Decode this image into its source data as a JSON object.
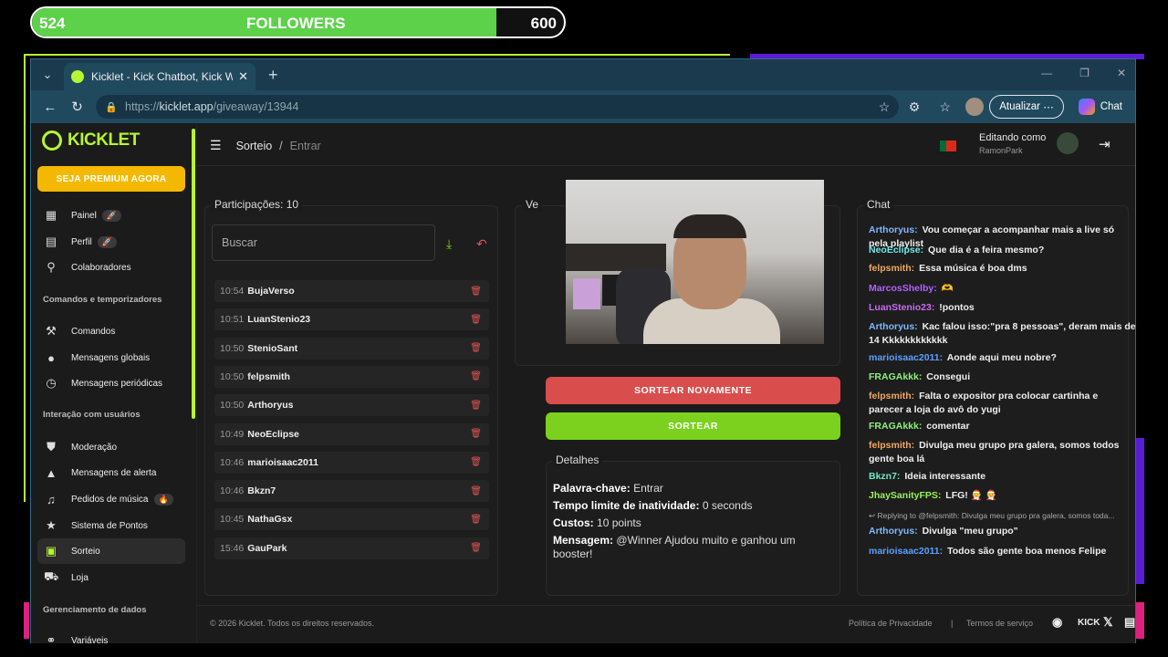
{
  "overlay": {
    "current": "524",
    "label": "FOLLOWERS",
    "goal": "600",
    "progress": 0.873
  },
  "browser": {
    "tab_title": "Kicklet - Kick Chatbot, Kick Widget",
    "url_scheme": "https://",
    "url_host": "kicklet.app",
    "url_path": "/giveaway/13944",
    "update_label": "Atualizar",
    "chat_label": "Chat"
  },
  "sidebar": {
    "logo": "KICKLET",
    "premium": "SEJA PREMIUM AGORA",
    "items": [
      {
        "label": "Painel",
        "icon": "dashboard-icon",
        "glyph": "▦"
      },
      {
        "label": "Perfil",
        "icon": "profile-icon",
        "glyph": "▤"
      },
      {
        "label": "Colaboradores",
        "icon": "collaborators-icon",
        "glyph": "⚲"
      },
      {
        "label": "Comandos",
        "icon": "hammer-icon",
        "glyph": "⚒"
      },
      {
        "label": "Mensagens globais",
        "icon": "chat-bubble-icon",
        "glyph": "●"
      },
      {
        "label": "Mensagens periódicas",
        "icon": "clock-icon",
        "glyph": "◷"
      },
      {
        "label": "Moderação",
        "icon": "shield-icon",
        "glyph": "⛊"
      },
      {
        "label": "Mensagens de alerta",
        "icon": "warning-icon",
        "glyph": "▲"
      },
      {
        "label": "Pedidos de música",
        "icon": "music-icon",
        "glyph": "♫"
      },
      {
        "label": "Sistema de Pontos",
        "icon": "star-icon",
        "glyph": "★"
      },
      {
        "label": "Sorteio",
        "icon": "gift-icon",
        "glyph": "▣"
      },
      {
        "label": "Loja",
        "icon": "cart-icon",
        "glyph": "⛟"
      },
      {
        "label": "Variáveis",
        "icon": "variables-icon",
        "glyph": "⚭"
      }
    ],
    "sections": [
      "Comandos e temporizadores",
      "Interação com usuários",
      "Gerenciamento de dados"
    ]
  },
  "header": {
    "crumb1": "Sorteio",
    "crumb2": "Entrar",
    "editing": "Editando como",
    "user": "RamonPark"
  },
  "participants": {
    "title": "Participações: 10",
    "search_placeholder": "Buscar",
    "rows": [
      {
        "time": "10:54",
        "name": "BujaVerso"
      },
      {
        "time": "10:51",
        "name": "LuanStenio23"
      },
      {
        "time": "10:50",
        "name": "StenioSant"
      },
      {
        "time": "10:50",
        "name": "felpsmith"
      },
      {
        "time": "10:50",
        "name": "Arthoryus"
      },
      {
        "time": "10:49",
        "name": "NeoEclipse"
      },
      {
        "time": "10:46",
        "name": "marioisaac2011"
      },
      {
        "time": "10:46",
        "name": "Bkzn7"
      },
      {
        "time": "10:45",
        "name": "NathaGsx"
      },
      {
        "time": "15:46",
        "name": "GauPark"
      }
    ]
  },
  "winner": {
    "title_fragment": "Ve",
    "redraw": "SORTEAR NOVAMENTE",
    "draw": "SORTEAR"
  },
  "details": {
    "title": "Detalhes",
    "keyword_label": "Palavra-chave:",
    "keyword": "Entrar",
    "timeout_label": "Tempo limite de inatividade:",
    "timeout": "0 seconds",
    "cost_label": "Custos:",
    "cost": "10 points",
    "message_label": "Mensagem:",
    "message_l1": "@Winner Ajudou muito e ganhou um",
    "message_l2": "booster!"
  },
  "chat": {
    "title": "Chat",
    "messages": [
      {
        "user": "Arthoryus:",
        "color": "#7fb8ff",
        "l1": "Vou começar a acompanhar mais a live só",
        "l2": "pela playlist"
      },
      {
        "user": "NeoEclipse:",
        "color": "#6ee7e7",
        "l1": "Que dia é a feira mesmo?",
        "l2": ""
      },
      {
        "user": "felpsmith:",
        "color": "#f0a860",
        "l1": "Essa música é boa dms",
        "l2": ""
      },
      {
        "user": "MarcosShelby:",
        "color": "#b061ff",
        "l1": "🫶",
        "l2": ""
      },
      {
        "user": "LuanStenio23:",
        "color": "#c86bf0",
        "l1": "!pontos",
        "l2": ""
      },
      {
        "user": "Arthoryus:",
        "color": "#7fb8ff",
        "l1": "Kac falou isso:\"pra 8 pessoas\", deram mais de",
        "l2": "14 Kkkkkkkkkkkk"
      },
      {
        "user": "marioisaac2011:",
        "color": "#5aa0ff",
        "l1": "Aonde aqui meu nobre?",
        "l2": ""
      },
      {
        "user": "FRAGAkkk:",
        "color": "#8ff07a",
        "l1": "Consegui",
        "l2": ""
      },
      {
        "user": "felpsmith:",
        "color": "#f0a860",
        "l1": "Falta o expositor pra colocar cartinha e",
        "l2": "parecer a loja do avô do yugi"
      },
      {
        "user": "FRAGAkkk:",
        "color": "#8ff07a",
        "l1": "comentar",
        "l2": ""
      },
      {
        "user": "felpsmith:",
        "color": "#f0a860",
        "l1": "Divulga meu grupo pra galera, somos todos",
        "l2": "gente boa lá"
      },
      {
        "user": "Bkzn7:",
        "color": "#6ee7c7",
        "l1": "Ideia interessante",
        "l2": ""
      },
      {
        "user": "JhaySanityFPS:",
        "color": "#9cf05a",
        "l1": "LFG! 🧑‍🎄 🧑‍🎄",
        "l2": ""
      },
      {
        "user": "",
        "color": "#aaaaaa",
        "l1": "↩ Replying to @felpsmith: Divulga meu grupo pra galera, somos toda...",
        "l2": ""
      },
      {
        "user": "Arthoryus:",
        "color": "#7fb8ff",
        "l1": "Divulga \"meu grupo\"",
        "l2": ""
      },
      {
        "user": "marioisaac2011:",
        "color": "#5aa0ff",
        "l1": "Todos são gente boa menos Felipe",
        "l2": ""
      }
    ]
  },
  "footer": {
    "copy": "© 2026 Kicklet. Todos os direitos reservados.",
    "privacy": "Política de Privacidade",
    "sep": "|",
    "terms": "Termos de serviço",
    "kick": "KICK",
    "x": "𝕏"
  }
}
